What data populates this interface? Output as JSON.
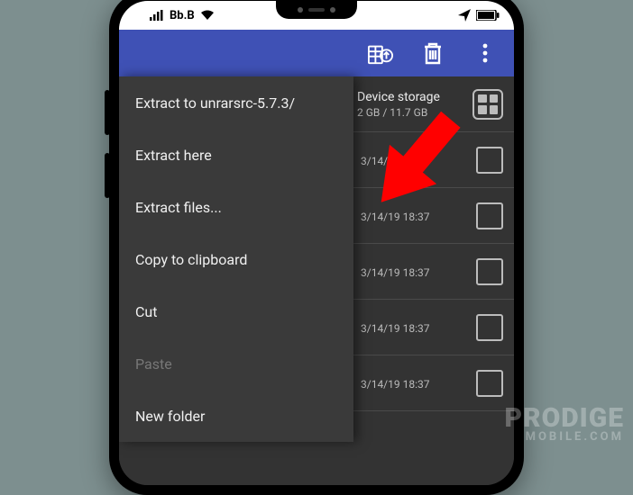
{
  "status": {
    "carrier": "Bb.B"
  },
  "list": {
    "storage": {
      "line1": "Device storage",
      "line2": "2 GB / 11.7 GB"
    },
    "rows": [
      {
        "date": "3/14/19 18:37"
      },
      {
        "date": "3/14/19 18:37"
      },
      {
        "date": "3/14/19 18:37"
      },
      {
        "date": "3/14/19 18:37"
      },
      {
        "date": "3/14/19 18:37"
      }
    ]
  },
  "menu": {
    "extract_to": "Extract to unrarsrc-5.7.3/",
    "extract_here": "Extract here",
    "extract_files": "Extract files...",
    "copy": "Copy to clipboard",
    "cut": "Cut",
    "paste": "Paste",
    "new_folder": "New folder"
  },
  "watermark": {
    "line1": "PRODIGE",
    "line2": "MOBILE.COM"
  },
  "colors": {
    "appbar": "#3f51b5",
    "arrow": "#ff0000"
  }
}
